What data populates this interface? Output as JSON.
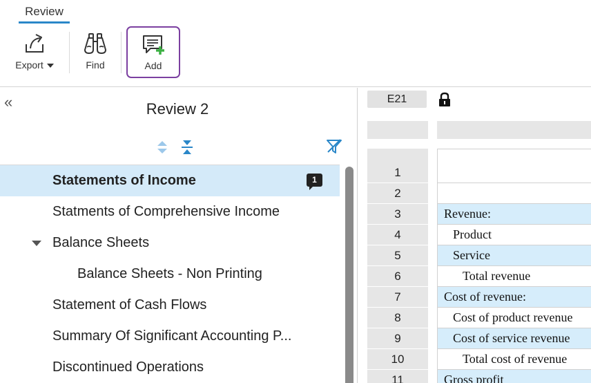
{
  "ribbon": {
    "active_tab": "Review",
    "tools": {
      "export_label": "Export",
      "find_label": "Find",
      "add_label": "Add"
    }
  },
  "left_pane": {
    "title": "Review 2",
    "items": [
      {
        "label": "Statements of Income",
        "badge": "1",
        "selected": true
      },
      {
        "label": "Statments of Comprehensive Income"
      },
      {
        "label": "Balance Sheets",
        "expanded": true
      },
      {
        "label": "Balance Sheets - Non Printing",
        "indent": 1
      },
      {
        "label": "Statement of Cash Flows"
      },
      {
        "label": "Summary Of Significant Accounting P..."
      },
      {
        "label": "Discontinued Operations"
      }
    ]
  },
  "sheet": {
    "cell_ref": "E21",
    "rows": [
      {
        "num": "1",
        "text": "",
        "shaded": false
      },
      {
        "num": "2",
        "text": "",
        "shaded": false
      },
      {
        "num": "3",
        "text": "Revenue:",
        "shaded": true
      },
      {
        "num": "4",
        "text": "Product",
        "shaded": false
      },
      {
        "num": "5",
        "text": "Service",
        "shaded": true
      },
      {
        "num": "6",
        "text": "Total revenue",
        "shaded": false
      },
      {
        "num": "7",
        "text": "Cost of revenue:",
        "shaded": true
      },
      {
        "num": "8",
        "text": "Cost of product revenue",
        "shaded": false
      },
      {
        "num": "9",
        "text": "Cost of service revenue",
        "shaded": true
      },
      {
        "num": "10",
        "text": "Total cost of revenue",
        "shaded": false
      },
      {
        "num": "11",
        "text": "Gross profit",
        "shaded": true
      }
    ]
  },
  "colors": {
    "accent": "#2a87c8",
    "add_highlight": "#7b3fa0",
    "selected_row": "#d4eaf9",
    "shaded_cell": "#d6edfb"
  }
}
